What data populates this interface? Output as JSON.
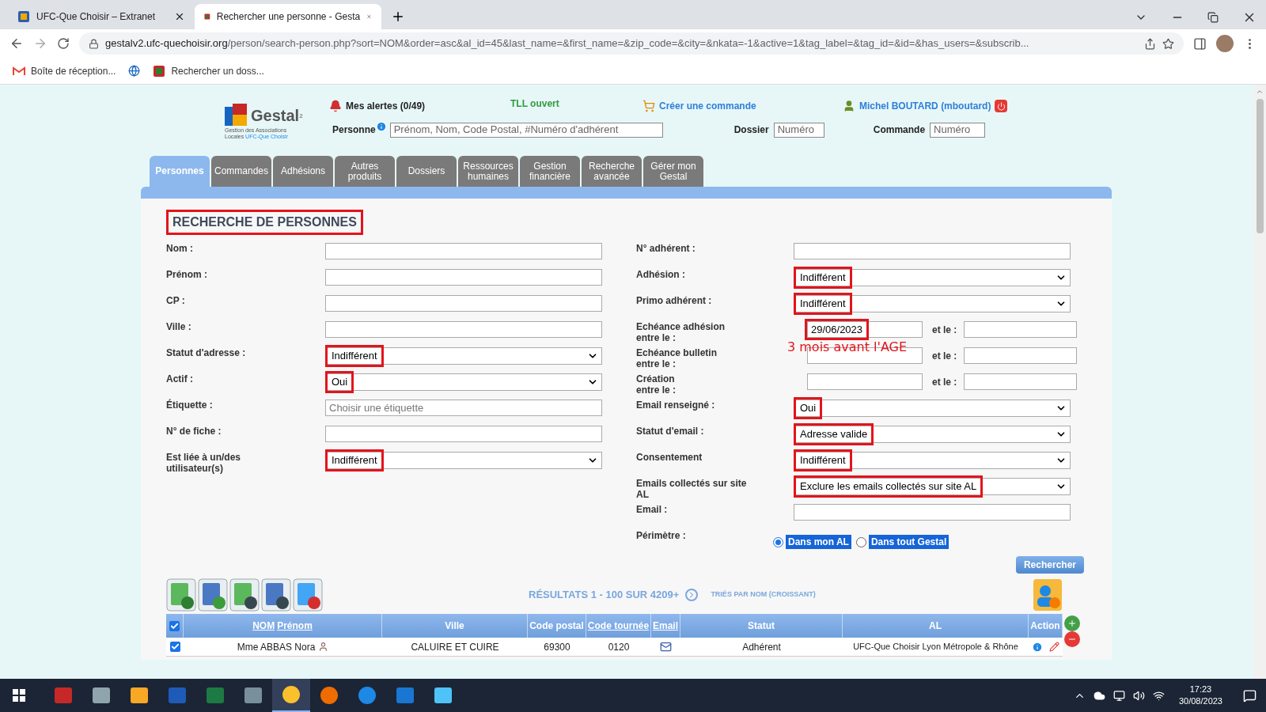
{
  "browser": {
    "tabs": [
      {
        "title": "UFC-Que Choisir – Extranet",
        "selected": false
      },
      {
        "title": "Rechercher une personne - Gesta",
        "selected": true
      }
    ],
    "url": {
      "host": "gestalv2.ufc-quechoisir.org",
      "path": "/person/search-person.php?sort=NOM&order=asc&al_id=45&last_name=&first_name=&zip_code=&city=&nkata=-1&active=1&tag_label=&tag_id=&id=&has_users=&subscrib..."
    },
    "bookmarks": [
      {
        "kind": "mail",
        "label": "Boîte de réception..."
      },
      {
        "kind": "globe"
      },
      {
        "kind": "site",
        "label": "Rechercher un doss..."
      }
    ]
  },
  "header": {
    "logo": {
      "name": "Gestal",
      "sup": "2",
      "tagline": "Gestion des Associations",
      "tagline2": "Locales",
      "brand": "UFC-Que Choisir"
    },
    "alerts": "Mes alertes (0/49)",
    "tll": "TLL ouvert",
    "create_order": "Créer une commande",
    "user": "Michel BOUTARD",
    "login": "(mboutard)",
    "person_label": "Personne",
    "person_placeholder": "Prénom, Nom, Code Postal, #Numéro d'adhérent",
    "dossier_label": "Dossier",
    "dossier_placeholder": "Numéro",
    "commande_label": "Commande",
    "commande_placeholder": "Numéro"
  },
  "nav_tabs": [
    {
      "label": "Personnes",
      "selected": true
    },
    {
      "label": "Commandes",
      "selected": false
    },
    {
      "label": "Adhésions",
      "selected": false
    },
    {
      "label": "Autres\nproduits",
      "selected": false
    },
    {
      "label": "Dossiers",
      "selected": false
    },
    {
      "label": "Ressources\nhumaines",
      "selected": false
    },
    {
      "label": "Gestion\nfinancière",
      "selected": false
    },
    {
      "label": "Recherche\navancée",
      "selected": false
    },
    {
      "label": "Gérer mon\nGestal",
      "selected": false
    }
  ],
  "form": {
    "title": "RECHERCHE DE PERSONNES",
    "title_annotated": true,
    "left": [
      {
        "kind": "text",
        "label": "Nom :"
      },
      {
        "kind": "text",
        "label": "Prénom :"
      },
      {
        "kind": "text",
        "label": "CP :"
      },
      {
        "kind": "text",
        "label": "Ville :"
      },
      {
        "kind": "select",
        "label": "Statut d'adresse :",
        "value": "Indifférent",
        "annotated": true
      },
      {
        "kind": "select",
        "label": "Actif :",
        "value": "Oui",
        "annotated": true
      },
      {
        "kind": "text",
        "label": "Étiquette :",
        "placeholder": "Choisir une étiquette"
      },
      {
        "kind": "text",
        "label": "N° de fiche :"
      },
      {
        "kind": "select",
        "label": "Est liée à un/des\nutilisateur(s)",
        "value": "Indifférent",
        "annotated": true
      }
    ],
    "right": [
      {
        "kind": "text",
        "label": "N° adhérent :"
      },
      {
        "kind": "select",
        "label": "Adhésion :",
        "value": "Indifférent",
        "annotated": true
      },
      {
        "kind": "select",
        "label": "Primo adhérent :",
        "value": "Indifférent",
        "annotated": true
      },
      {
        "kind": "range",
        "label": "Echéance adhésion\nentre le :",
        "from": "29/06/2023",
        "from_annotated": true,
        "to_label": "et le :",
        "note": "3 mois avant l'AGE"
      },
      {
        "kind": "range",
        "label": "Echéance bulletin\nentre le :",
        "to_label": "et le :"
      },
      {
        "kind": "range",
        "label": "Création\nentre le :",
        "to_label": "et le :"
      },
      {
        "kind": "select",
        "label": "Email renseigné :",
        "value": "Oui",
        "annotated": true
      },
      {
        "kind": "select",
        "label": "Statut d'email :",
        "value": "Adresse valide",
        "annotated": true
      },
      {
        "kind": "select",
        "label": "Consentement",
        "value": "Indifférent",
        "annotated": true
      },
      {
        "kind": "select",
        "label": "Emails collectés sur site\nAL",
        "value": "Exclure les emails collectés sur site AL",
        "annotated": true
      },
      {
        "kind": "text",
        "label": "Email :"
      },
      {
        "kind": "radio",
        "label": "Périmètre :",
        "options": [
          {
            "label": "Dans mon AL",
            "selected": true
          },
          {
            "label": "Dans tout Gestal",
            "selected": false
          }
        ]
      }
    ],
    "search_button": "Rechercher"
  },
  "results": {
    "summary": "RÉSULTATS 1 - 100 SUR 4209+",
    "sort": "TRIÉS PAR NOM (CROISSANT)"
  },
  "table": {
    "all_checked": true,
    "columns": [
      {
        "links": [
          "NOM",
          "Prénom"
        ]
      },
      {
        "label": "Ville"
      },
      {
        "label": "Code postal"
      },
      {
        "links": [
          "Code tournée"
        ]
      },
      {
        "links": [
          "Email"
        ]
      },
      {
        "label": "Statut"
      },
      {
        "label": "AL"
      },
      {
        "label": "Action"
      }
    ],
    "rows": [
      {
        "checked": true,
        "name": "Mme ABBAS Nora",
        "city": "CALUIRE ET CUIRE",
        "zip": "69300",
        "route": "0120",
        "status": "Adhérent",
        "al": "UFC-Que Choisir Lyon Métropole & Rhône"
      }
    ]
  },
  "taskbar": {
    "time": "17:23",
    "date": "30/08/2023"
  }
}
